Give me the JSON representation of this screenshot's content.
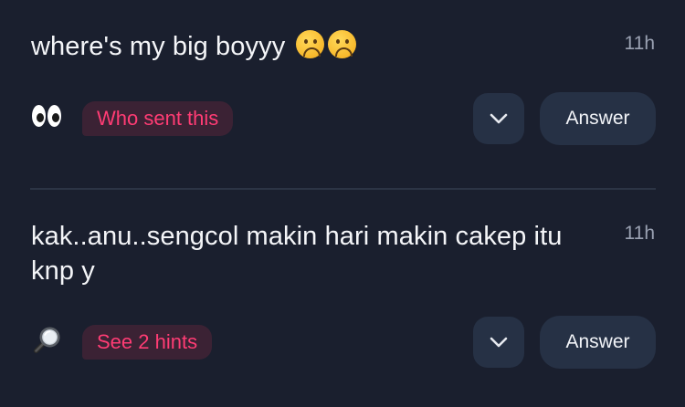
{
  "questions": [
    {
      "text": "where's my big boyyy",
      "trailing_emojis": [
        "frowning-face",
        "frowning-face"
      ],
      "time": "11h",
      "lead_icon": "eyes-emoji",
      "hint_label": "Who sent this",
      "answer_label": "Answer"
    },
    {
      "text": "kak..anu..sengcol makin hari makin cakep itu knp y",
      "time": "11h",
      "lead_icon": "magnifying-glass-emoji",
      "hint_label": "See 2 hints",
      "answer_label": "Answer"
    }
  ],
  "colors": {
    "background": "#1a1f2e",
    "button_bg": "#263145",
    "hint_text": "#ff3c74",
    "hint_bg": "#3b2234",
    "timestamp": "#9aa1b2"
  }
}
